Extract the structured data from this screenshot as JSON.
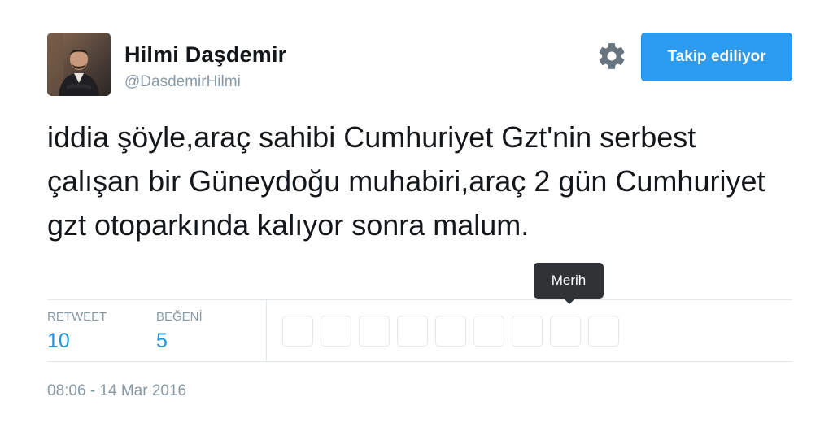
{
  "profile": {
    "display_name": "Hilmi Daşdemir",
    "handle": "@DasdemirHilmi"
  },
  "icons": {
    "settings": "gear-icon"
  },
  "follow_button": {
    "label": "Takip ediliyor",
    "color": "#2b9cf2"
  },
  "tweet": {
    "text": "iddia şöyle,araç sahibi Cumhuriyet Gzt'nin serbest çalışan bir Güneydoğu muhabiri,araç 2 gün Cumhuriyet gzt otoparkında kalıyor sonra malum."
  },
  "stats": {
    "retweet_label": "RETWEET",
    "retweet_count": "10",
    "like_label": "BEĞENİ",
    "like_count": "5"
  },
  "tooltip": {
    "text": "Merih"
  },
  "timestamp": "08:06 - 14 Mar 2016",
  "colors": {
    "link_blue": "#1b95e0",
    "muted_gray": "#8899a6",
    "text_dark": "#14171a"
  }
}
